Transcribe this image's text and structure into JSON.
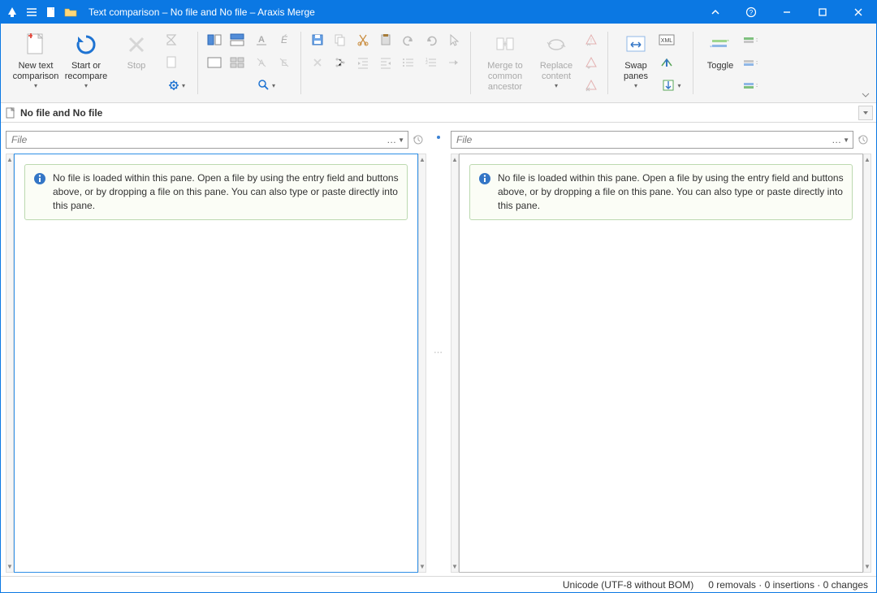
{
  "title": "Text comparison – No file and No file – Araxis Merge",
  "tabs": {
    "doc_title": "No file and No file"
  },
  "ribbon": {
    "new_text": "New text\ncomparison",
    "start": "Start or\nrecompare",
    "stop": "Stop",
    "merge_common": "Merge to\ncommon\nancestor",
    "replace": "Replace\ncontent",
    "swap": "Swap\npanes",
    "toggle": "Toggle"
  },
  "pane": {
    "file_placeholder": "File",
    "info_msg": "No file is loaded within this pane. Open a file by using the entry field and buttons above, or by dropping a file on this pane. You can also type or paste directly into this pane."
  },
  "status": {
    "encoding": "Unicode (UTF-8 without BOM)",
    "changes": "0 removals · 0 insertions · 0 changes"
  }
}
